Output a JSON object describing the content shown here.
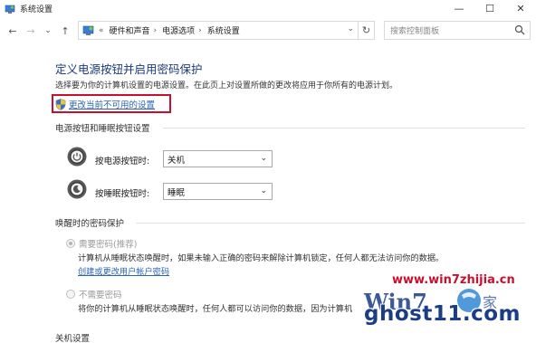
{
  "window": {
    "title": "系统设置",
    "controls": {
      "minimize": "—",
      "maximize": "☐",
      "close": "✕"
    }
  },
  "nav": {
    "back": "←",
    "forward": "→",
    "dropdown": "⌄",
    "up": "↑",
    "breadcrumb_prefix": "«",
    "breadcrumbs": [
      "硬件和声音",
      "电源选项",
      "系统设置"
    ],
    "separator": "›",
    "refresh": "↻",
    "search_placeholder": "搜索控制面板"
  },
  "content": {
    "heading": "定义电源按钮并启用密码保护",
    "subtitle": "选择要为你的计算机设置的电源设置。在此页上对设置所做的更改将应用于你所有的电源计划。",
    "change_link": "更改当前不可用的设置",
    "power_section": {
      "title": "电源按钮和睡眠按钮设置",
      "rows": [
        {
          "label": "按电源按钮时:",
          "value": "关机"
        },
        {
          "label": "按睡眠按钮时:",
          "value": "睡眠"
        }
      ]
    },
    "wake_section": {
      "title": "唤醒时的密码保护",
      "options": [
        {
          "label": "需要密码(推荐)",
          "selected": true,
          "desc_lines": [
            "计算机从睡眠状态唤醒时，如果未输入正确的密码来解除计算机锁定，任何人都无法访问你的数据。"
          ],
          "link": "创建或更改用户帐户密码"
        },
        {
          "label": "不需要密码",
          "selected": false,
          "desc_lines": [
            "将你的计算机从睡眠状态唤醒时，任何人都可以访问你的数据，因为计算机"
          ]
        }
      ]
    },
    "shutdown_section": {
      "title": "关机设置"
    }
  },
  "watermark": {
    "site": "www.win7zhijia.cn",
    "logo_text": "Win7之家",
    "ghost": "ghost11.com"
  },
  "colors": {
    "heading": "#1a3a7a",
    "link": "#2a64b4",
    "highlight_box": "#c8102e",
    "watermark_red": "#c8102e",
    "watermark_blue": "#1b3c86"
  }
}
